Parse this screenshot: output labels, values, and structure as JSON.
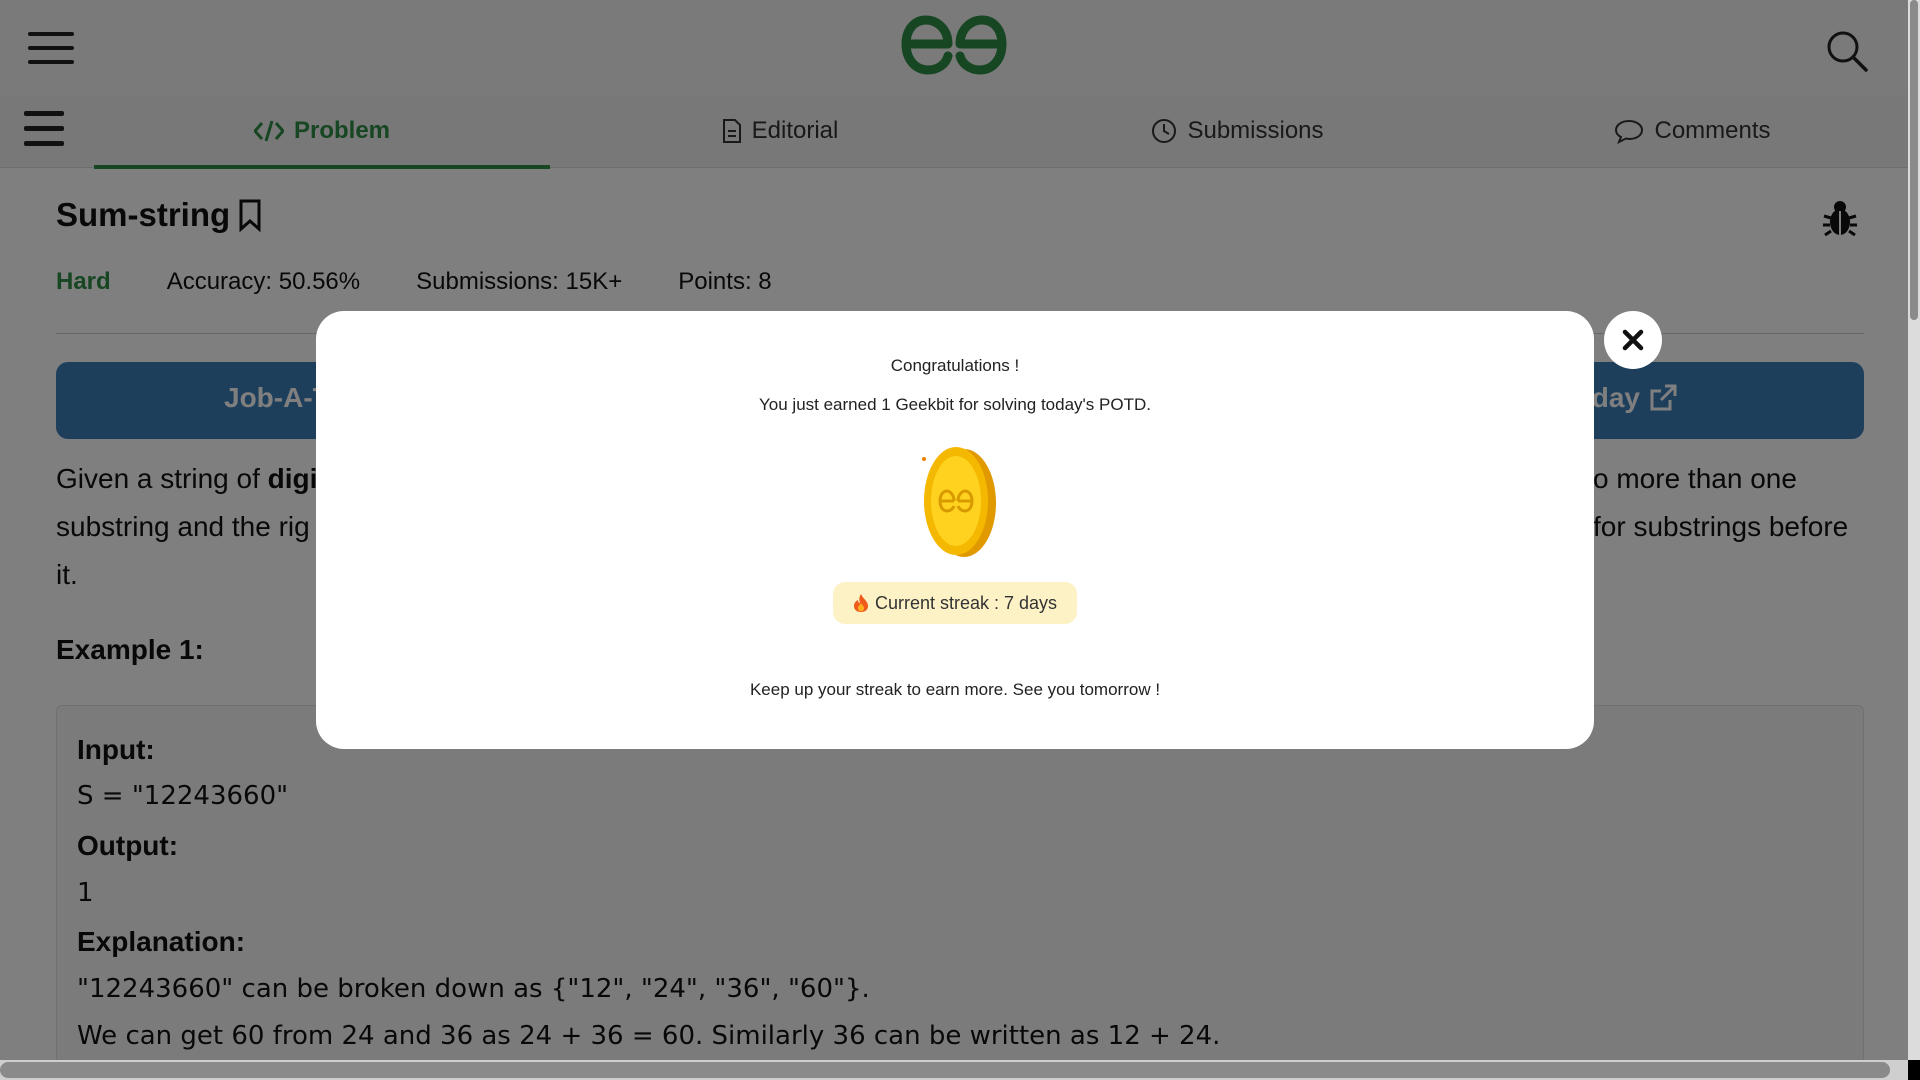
{
  "tabs": {
    "problem": "Problem",
    "editorial": "Editorial",
    "submissions": "Submissions",
    "comments": "Comments"
  },
  "problem": {
    "title": "Sum-string",
    "difficulty": "Hard",
    "accuracy": "Accuracy: 50.56%",
    "submissions": "Submissions: 15K+",
    "points": "Points: 8"
  },
  "banner": {
    "left_text": "Job-A-T",
    "right_text": "oday"
  },
  "description": {
    "p1_start": "Given a string of ",
    "p1_bold": "digi",
    "p1_right": "o more than one",
    "p2_left": "substring and the rig",
    "p2_right": "for substrings before",
    "p3": "it."
  },
  "example": {
    "heading": "Example 1:",
    "input_label": "Input:",
    "input_value": "S = \"12243660\"",
    "output_label": "Output:",
    "output_value": "1",
    "explanation_label": "Explanation:",
    "explanation_1": "\"12243660\" can be broken down as {\"12\", \"24\", \"36\", \"60\"}.",
    "explanation_2": "We can get 60 from 24 and 36 as 24 + 36 = 60. Similarly 36 can be written as 12 + 24."
  },
  "modal": {
    "congrats": "Congratulations !",
    "earned": "You just earned 1 Geekbit for solving today's POTD.",
    "streak": "Current streak : 7 days",
    "keep": "Keep up your streak to earn more. See you tomorrow !"
  },
  "colors": {
    "brand_green": "#2f8d46",
    "banner_blue": "#3d7fb6",
    "streak_bg": "#fcf2c6",
    "coin_gold": "#f5b800"
  },
  "icons": [
    "menu-icon",
    "gfg-logo",
    "search-icon",
    "code-icon",
    "document-icon",
    "clock-icon",
    "comment-icon",
    "bookmark-icon",
    "bug-icon",
    "external-link-icon",
    "coin-icon",
    "fire-icon",
    "close-icon"
  ]
}
